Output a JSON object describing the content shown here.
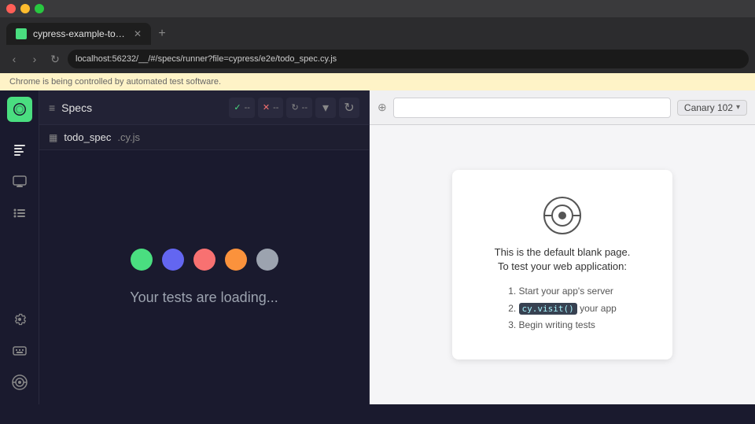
{
  "browser": {
    "tab_title": "cypress-example-todomc",
    "address": "localhost:56232/__/#/specs/runner?file=cypress/e2e/todo_spec.cy.js",
    "info_bar": "Chrome is being controlled by automated test software."
  },
  "sidebar": {
    "logo_alt": "cypress-logo",
    "icons": [
      "specs-icon",
      "runner-icon",
      "list-icon",
      "settings-icon",
      "shortcut-icon",
      "cy-icon"
    ]
  },
  "panel": {
    "title": "Specs",
    "toolbar": {
      "check_icon": "✓",
      "dash1": "--",
      "cross_icon": "✕",
      "dash2": "--",
      "spin_icon": "↻",
      "dash3": "--"
    },
    "spec_file": {
      "name": "todo_spec",
      "ext": ".cy.js"
    },
    "loading_text": "Your tests are loading..."
  },
  "preview": {
    "toolbar": {
      "url_placeholder": "",
      "badge_label": "Canary 102"
    },
    "blank_page": {
      "title_line1": "This is the default blank page.",
      "title_line2": "To test your web application:",
      "step1": "Start your app's server",
      "step2_prefix": "",
      "cy_visit": "cy.visit()",
      "step2_suffix": " your app",
      "step3": "Begin writing tests"
    }
  }
}
